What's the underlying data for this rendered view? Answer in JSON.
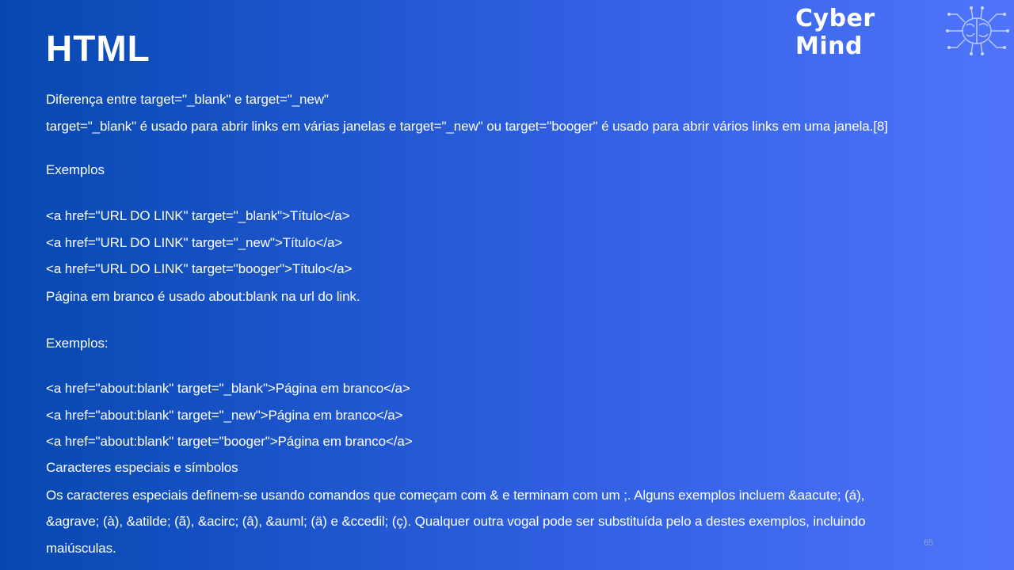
{
  "slide": {
    "title": "HTML",
    "logo_text": "Cyber Mind",
    "page_number": "65",
    "lines": [
      "Diferença entre target=\"_blank\" e target=\"_new\"",
      "target=\"_blank\" é usado para abrir links em várias janelas e target=\"_new\" ou target=\"booger\" é usado para abrir vários links em uma janela.[8]",
      "Exemplos",
      "<a href=\"URL DO LINK\" target=\"_blank\">Título</a>",
      "<a href=\"URL DO LINK\" target=\"_new\">Título</a>",
      "<a href=\"URL DO LINK\" target=\"booger\">Título</a>",
      "Página em branco é usado about:blank na url do link.",
      "Exemplos:",
      "<a href=\"about:blank\" target=\"_blank\">Página em branco</a>",
      "<a href=\"about:blank\" target=\"_new\">Página em branco</a>",
      "<a href=\"about:blank\" target=\"booger\">Página em branco</a>",
      "Caracteres especiais e símbolos",
      "Os caracteres especiais definem-se usando comandos que começam com & e terminam com um ;. Alguns exemplos incluem &aacute; (á),",
      "&agrave; (à), &atilde; (ã), &acirc; (â), &auml; (ä) e &ccedil; (ç). Qualquer outra vogal pode ser substituída pelo a destes exemplos, incluindo",
      "maiúsculas."
    ]
  },
  "colors": {
    "background_left": "#0648b0",
    "background_right": "#4f74fb",
    "text": "#ffffff"
  },
  "icons": [
    "brain-circuit-icon"
  ]
}
